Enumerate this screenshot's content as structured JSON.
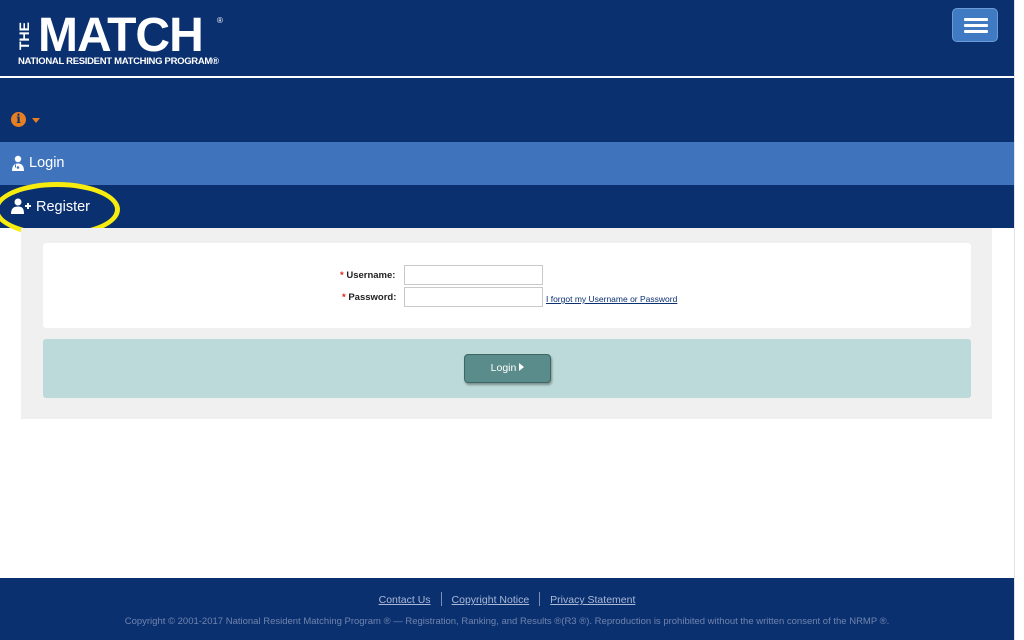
{
  "brand": {
    "the": "THE",
    "word": "MATCH",
    "registered": "®",
    "subtitle": "NATIONAL RESIDENT MATCHING PROGRAM®"
  },
  "nav": {
    "login": "Login",
    "register": "Register"
  },
  "form": {
    "required_mark": "*",
    "username_label": "Username:",
    "password_label": "Password:",
    "username_value": "",
    "password_value": "",
    "forgot_link": "I forgot my Username or Password",
    "login_button": "Login"
  },
  "footer": {
    "links": [
      "Contact Us",
      "Copyright Notice",
      "Privacy Statement"
    ],
    "copyright": "Copyright © 2001-2017 National Resident Matching Program ®   —   Registration, Ranking, and Results  ®(R3 ®). Reproduction is prohibited without the written consent of the NRMP ®."
  },
  "colors": {
    "header_bg": "#0b3070",
    "login_nav_bg": "#3f74bd",
    "info_icon": "#e67e22",
    "highlight_ring": "#f7ec0d",
    "action_bar": "#bcdad9",
    "login_button": "#5a8c8b"
  },
  "icons": {
    "menu": "hamburger-icon",
    "info": "info-circle-icon",
    "login": "user-doctor-icon",
    "register": "user-plus-icon"
  }
}
